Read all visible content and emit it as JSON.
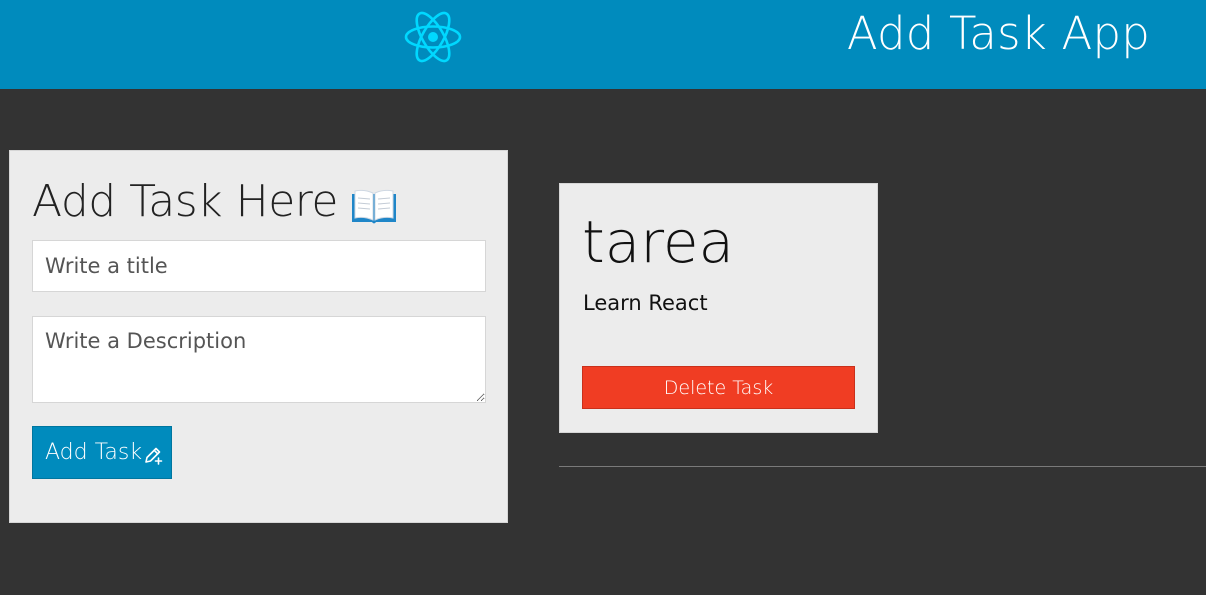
{
  "header": {
    "app_title": "Add Task App",
    "logo_icon": "react-logo-icon",
    "background_color": "#008bbd",
    "logo_color": "#00d8ff"
  },
  "form": {
    "heading": "Add Task Here",
    "heading_icon": "open-book-icon",
    "title_input": {
      "placeholder": "Write a title",
      "value": ""
    },
    "description_input": {
      "placeholder": "Write a Description",
      "value": ""
    },
    "add_button": {
      "label": "Add Task",
      "icon": "pencil-plus-icon",
      "color": "#008bbd"
    }
  },
  "tasks": [
    {
      "title": "tarea",
      "description": "Learn React",
      "delete_label": "Delete Task",
      "delete_color": "#f03d23"
    }
  ],
  "theme": {
    "page_background": "#333333",
    "card_background": "#ececec"
  }
}
